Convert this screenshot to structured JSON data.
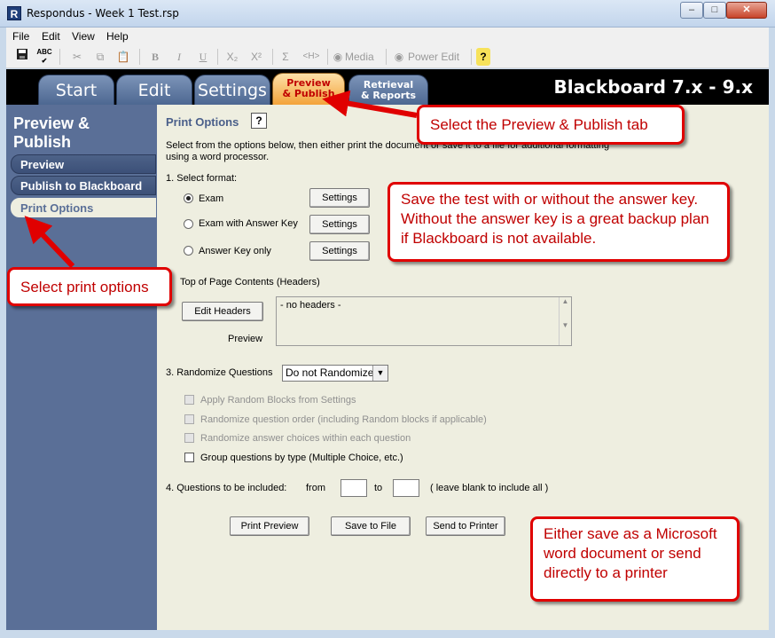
{
  "window": {
    "title": "Respondus - Week 1 Test.rsp",
    "app_icon_letter": "R",
    "minimize": "–",
    "maximize": "□",
    "close": "✕"
  },
  "menu": [
    "File",
    "Edit",
    "View",
    "Help"
  ],
  "toolbar": {
    "bold": "B",
    "italic": "I",
    "underline": "U",
    "subscript": "X₂",
    "superscript": "X²",
    "sigma": "Σ",
    "html": "<H>",
    "media": "Media",
    "power_edit": "Power Edit",
    "help": "?"
  },
  "tabs": {
    "start": "Start",
    "edit": "Edit",
    "settings": "Settings",
    "preview_line1": "Preview",
    "preview_line2": "& Publish",
    "retrieval_line1": "Retrieval",
    "retrieval_line2": "& Reports",
    "platform": "Blackboard 7.x - 9.x"
  },
  "sidebar": {
    "heading_line1": "Preview &",
    "heading_line2": "Publish",
    "items": [
      "Preview",
      "Publish to Blackboard",
      "Print Options"
    ],
    "selected_index": 2
  },
  "main": {
    "title": "Print Options",
    "help_icon": "?",
    "intro_line1": "Select from the options below, then either print the document or save it to a file for additional formatting",
    "intro_line2": "using a word processor.",
    "select_format": "1.  Select format:",
    "formats": [
      "Exam",
      "Exam with Answer Key",
      "Answer Key only"
    ],
    "format_selected_index": 0,
    "settings_label": "Settings",
    "top_of_page": "Top of Page Contents (Headers)",
    "edit_headers": "Edit Headers",
    "preview_label": "Preview",
    "headers_value": "- no headers -",
    "randomize_label": "3.  Randomize Questions",
    "randomize_value": "Do not Randomize",
    "options": [
      {
        "label": "Apply Random Blocks from Settings",
        "enabled": false,
        "checked": false
      },
      {
        "label": "Randomize question order (including Random blocks if applicable)",
        "enabled": false,
        "checked": false
      },
      {
        "label": "Randomize answer choices within each question",
        "enabled": false,
        "checked": false
      },
      {
        "label": "Group questions by type (Multiple Choice, etc.)",
        "enabled": true,
        "checked": false
      }
    ],
    "questions_label": "4.  Questions to be included:",
    "from_label": "from",
    "to_label": "to",
    "blank_hint": "( leave blank to include all )",
    "from_value": "",
    "to_value": "",
    "print_preview": "Print Preview",
    "save_to_file": "Save to File",
    "send_to_printer": "Send to Printer"
  },
  "callouts": {
    "tab": "Select the Preview & Publish tab",
    "answer_key": "Save the test with or without the answer key.  Without the answer key is a great backup plan if Blackboard is not available.",
    "print_options": "Select print options",
    "save": "Either save as a Microsoft word document or send directly to a printer"
  },
  "colors": {
    "callout_red": "#e00000",
    "sidebar": "#5a6f97",
    "tab_selected": "#f3a33a"
  }
}
